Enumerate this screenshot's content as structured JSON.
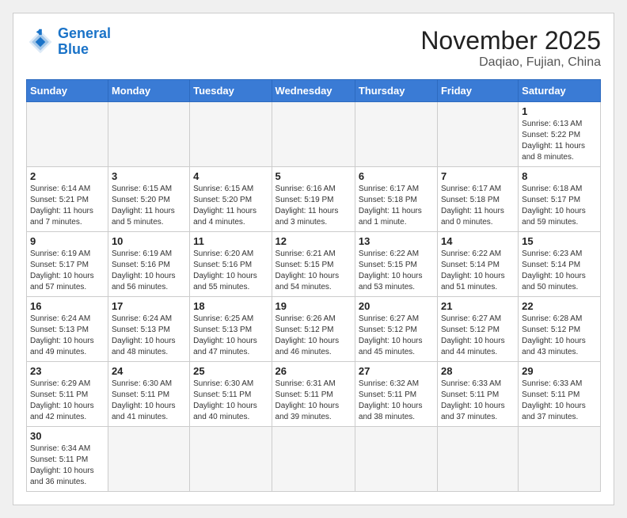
{
  "logo": {
    "line1": "General",
    "line2": "Blue"
  },
  "title": "November 2025",
  "subtitle": "Daqiao, Fujian, China",
  "weekdays": [
    "Sunday",
    "Monday",
    "Tuesday",
    "Wednesday",
    "Thursday",
    "Friday",
    "Saturday"
  ],
  "weeks": [
    [
      {
        "day": "",
        "info": ""
      },
      {
        "day": "",
        "info": ""
      },
      {
        "day": "",
        "info": ""
      },
      {
        "day": "",
        "info": ""
      },
      {
        "day": "",
        "info": ""
      },
      {
        "day": "",
        "info": ""
      },
      {
        "day": "1",
        "info": "Sunrise: 6:13 AM\nSunset: 5:22 PM\nDaylight: 11 hours\nand 8 minutes."
      }
    ],
    [
      {
        "day": "2",
        "info": "Sunrise: 6:14 AM\nSunset: 5:21 PM\nDaylight: 11 hours\nand 7 minutes."
      },
      {
        "day": "3",
        "info": "Sunrise: 6:15 AM\nSunset: 5:20 PM\nDaylight: 11 hours\nand 5 minutes."
      },
      {
        "day": "4",
        "info": "Sunrise: 6:15 AM\nSunset: 5:20 PM\nDaylight: 11 hours\nand 4 minutes."
      },
      {
        "day": "5",
        "info": "Sunrise: 6:16 AM\nSunset: 5:19 PM\nDaylight: 11 hours\nand 3 minutes."
      },
      {
        "day": "6",
        "info": "Sunrise: 6:17 AM\nSunset: 5:18 PM\nDaylight: 11 hours\nand 1 minute."
      },
      {
        "day": "7",
        "info": "Sunrise: 6:17 AM\nSunset: 5:18 PM\nDaylight: 11 hours\nand 0 minutes."
      },
      {
        "day": "8",
        "info": "Sunrise: 6:18 AM\nSunset: 5:17 PM\nDaylight: 10 hours\nand 59 minutes."
      }
    ],
    [
      {
        "day": "9",
        "info": "Sunrise: 6:19 AM\nSunset: 5:17 PM\nDaylight: 10 hours\nand 57 minutes."
      },
      {
        "day": "10",
        "info": "Sunrise: 6:19 AM\nSunset: 5:16 PM\nDaylight: 10 hours\nand 56 minutes."
      },
      {
        "day": "11",
        "info": "Sunrise: 6:20 AM\nSunset: 5:16 PM\nDaylight: 10 hours\nand 55 minutes."
      },
      {
        "day": "12",
        "info": "Sunrise: 6:21 AM\nSunset: 5:15 PM\nDaylight: 10 hours\nand 54 minutes."
      },
      {
        "day": "13",
        "info": "Sunrise: 6:22 AM\nSunset: 5:15 PM\nDaylight: 10 hours\nand 53 minutes."
      },
      {
        "day": "14",
        "info": "Sunrise: 6:22 AM\nSunset: 5:14 PM\nDaylight: 10 hours\nand 51 minutes."
      },
      {
        "day": "15",
        "info": "Sunrise: 6:23 AM\nSunset: 5:14 PM\nDaylight: 10 hours\nand 50 minutes."
      }
    ],
    [
      {
        "day": "16",
        "info": "Sunrise: 6:24 AM\nSunset: 5:13 PM\nDaylight: 10 hours\nand 49 minutes."
      },
      {
        "day": "17",
        "info": "Sunrise: 6:24 AM\nSunset: 5:13 PM\nDaylight: 10 hours\nand 48 minutes."
      },
      {
        "day": "18",
        "info": "Sunrise: 6:25 AM\nSunset: 5:13 PM\nDaylight: 10 hours\nand 47 minutes."
      },
      {
        "day": "19",
        "info": "Sunrise: 6:26 AM\nSunset: 5:12 PM\nDaylight: 10 hours\nand 46 minutes."
      },
      {
        "day": "20",
        "info": "Sunrise: 6:27 AM\nSunset: 5:12 PM\nDaylight: 10 hours\nand 45 minutes."
      },
      {
        "day": "21",
        "info": "Sunrise: 6:27 AM\nSunset: 5:12 PM\nDaylight: 10 hours\nand 44 minutes."
      },
      {
        "day": "22",
        "info": "Sunrise: 6:28 AM\nSunset: 5:12 PM\nDaylight: 10 hours\nand 43 minutes."
      }
    ],
    [
      {
        "day": "23",
        "info": "Sunrise: 6:29 AM\nSunset: 5:11 PM\nDaylight: 10 hours\nand 42 minutes."
      },
      {
        "day": "24",
        "info": "Sunrise: 6:30 AM\nSunset: 5:11 PM\nDaylight: 10 hours\nand 41 minutes."
      },
      {
        "day": "25",
        "info": "Sunrise: 6:30 AM\nSunset: 5:11 PM\nDaylight: 10 hours\nand 40 minutes."
      },
      {
        "day": "26",
        "info": "Sunrise: 6:31 AM\nSunset: 5:11 PM\nDaylight: 10 hours\nand 39 minutes."
      },
      {
        "day": "27",
        "info": "Sunrise: 6:32 AM\nSunset: 5:11 PM\nDaylight: 10 hours\nand 38 minutes."
      },
      {
        "day": "28",
        "info": "Sunrise: 6:33 AM\nSunset: 5:11 PM\nDaylight: 10 hours\nand 37 minutes."
      },
      {
        "day": "29",
        "info": "Sunrise: 6:33 AM\nSunset: 5:11 PM\nDaylight: 10 hours\nand 37 minutes."
      }
    ],
    [
      {
        "day": "30",
        "info": "Sunrise: 6:34 AM\nSunset: 5:11 PM\nDaylight: 10 hours\nand 36 minutes."
      },
      {
        "day": "",
        "info": ""
      },
      {
        "day": "",
        "info": ""
      },
      {
        "day": "",
        "info": ""
      },
      {
        "day": "",
        "info": ""
      },
      {
        "day": "",
        "info": ""
      },
      {
        "day": "",
        "info": ""
      }
    ]
  ]
}
